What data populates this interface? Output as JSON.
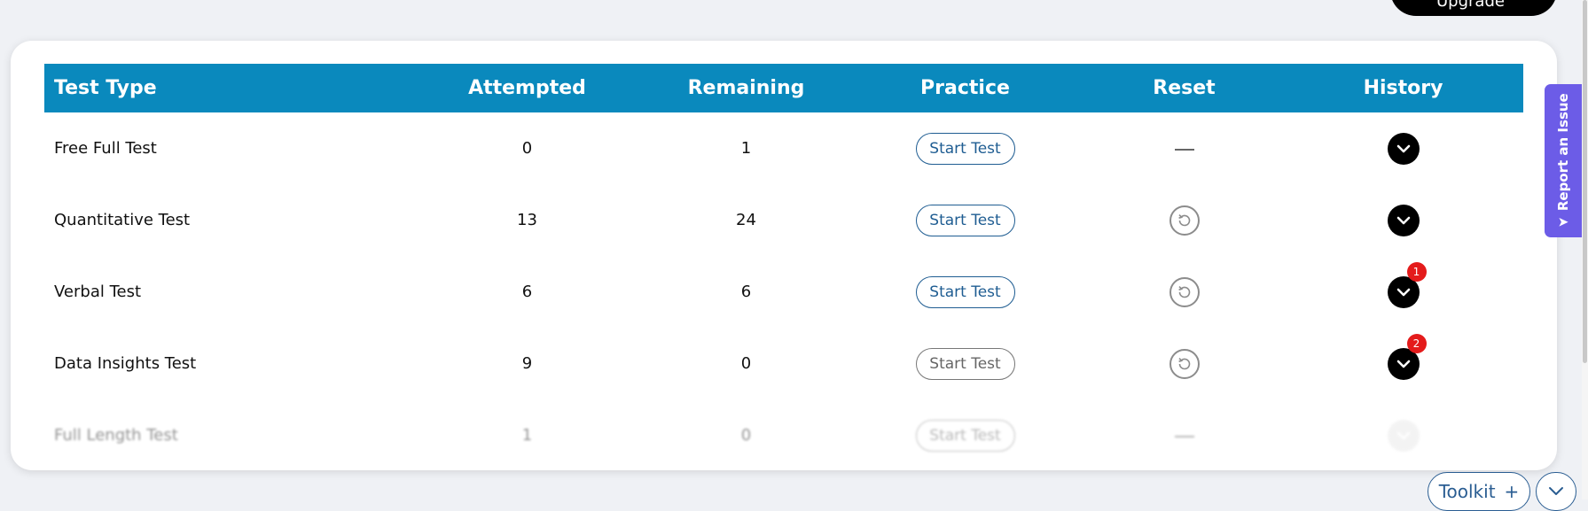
{
  "header_pill_label": "Upgrade",
  "table": {
    "headers": [
      "Test Type",
      "Attempted",
      "Remaining",
      "Practice",
      "Reset",
      "History"
    ],
    "rows": [
      {
        "name": "Free Full Test",
        "attempted": "0",
        "remaining": "1",
        "practice": "Start Test",
        "reset": "none",
        "badge": ""
      },
      {
        "name": "Quantitative Test",
        "attempted": "13",
        "remaining": "24",
        "practice": "Start Test",
        "reset": "reset-icon",
        "badge": ""
      },
      {
        "name": "Verbal Test",
        "attempted": "6",
        "remaining": "6",
        "practice": "Start Test",
        "reset": "reset-icon",
        "badge": "1"
      },
      {
        "name": "Data Insights Test",
        "attempted": "9",
        "remaining": "0",
        "practice": "Start Test",
        "reset": "reset-icon",
        "badge": "2"
      },
      {
        "name": "Full Length Test",
        "attempted": "1",
        "remaining": "0",
        "practice": "Start Test",
        "reset": "none",
        "badge": ""
      }
    ]
  },
  "report_tab": {
    "label": "Report an Issue"
  },
  "toolkit": {
    "label": "Toolkit",
    "plus": "+"
  },
  "colors": {
    "header_bg": "#0a89bd",
    "report_tab": "#6c5ce7",
    "badge": "#e41b1b",
    "button_border": "#1f5d92"
  }
}
